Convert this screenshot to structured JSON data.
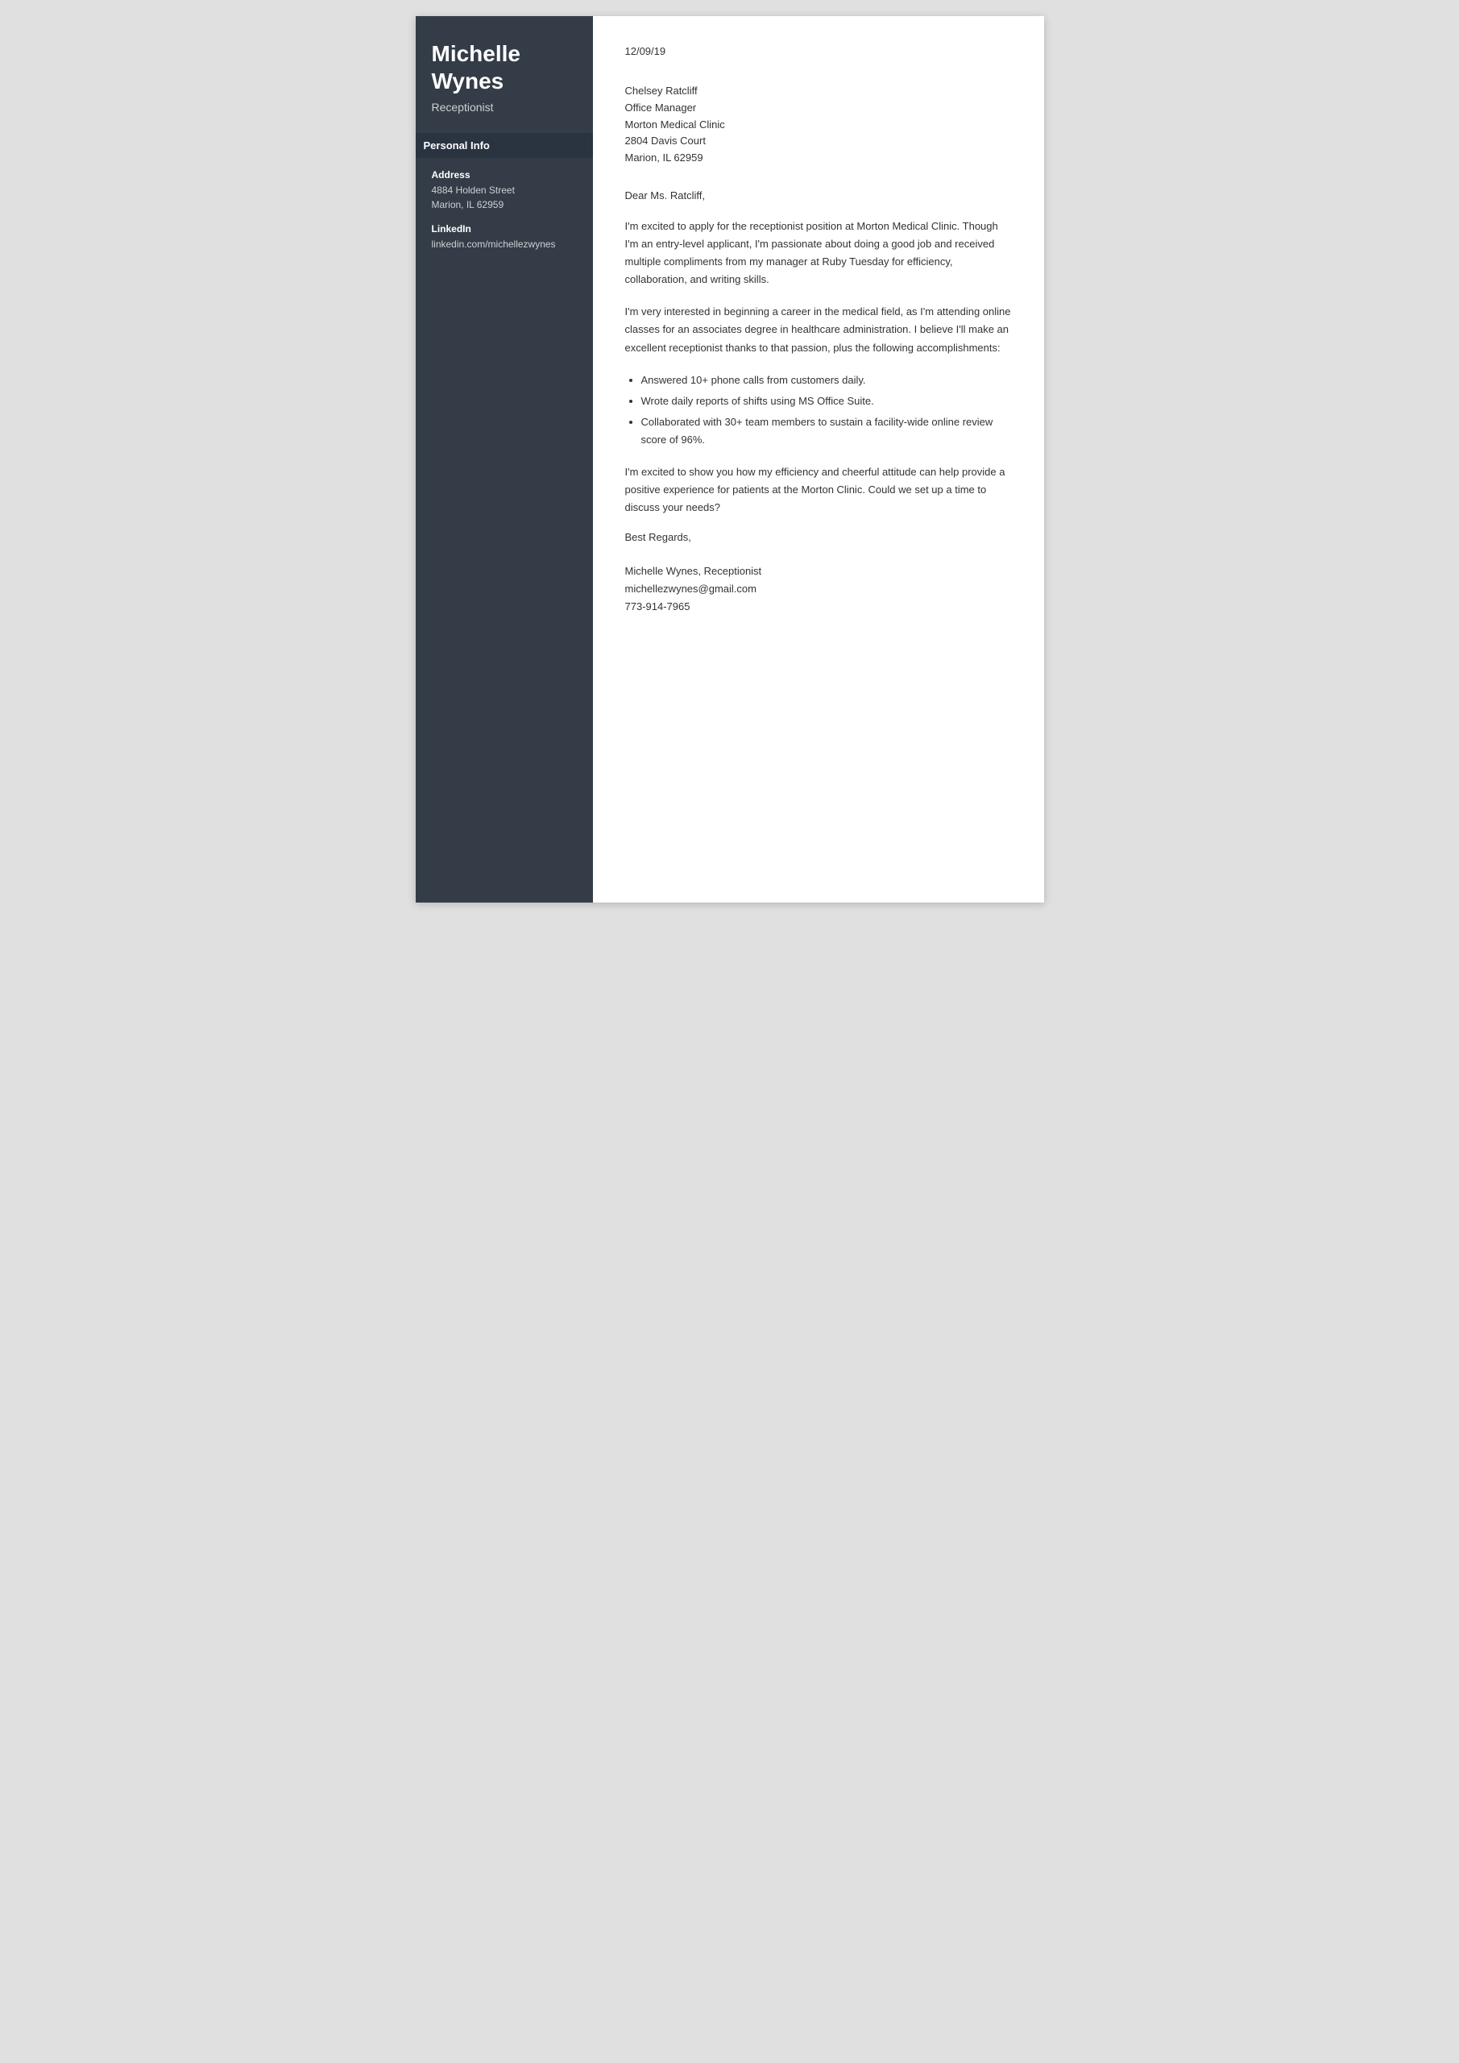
{
  "sidebar": {
    "name_line1": "Michelle",
    "name_line2": "Wynes",
    "title": "Receptionist",
    "personal_info_header": "Personal Info",
    "address_label": "Address",
    "address_line1": "4884 Holden Street",
    "address_line2": "Marion, IL 62959",
    "linkedin_label": "LinkedIn",
    "linkedin_value": "linkedin.com/michellezwynes"
  },
  "letter": {
    "date": "12/09/19",
    "recipient_name": "Chelsey Ratcliff",
    "recipient_title": "Office Manager",
    "recipient_company": "Morton Medical Clinic",
    "recipient_address": "2804 Davis Court",
    "recipient_city": "Marion, IL 62959",
    "salutation": "Dear Ms. Ratcliff,",
    "paragraph1": "I'm excited to apply for the receptionist position at Morton Medical Clinic. Though I'm an entry-level applicant, I'm passionate about doing a good job and received multiple compliments from my manager at Ruby Tuesday for efficiency, collaboration, and writing skills.",
    "paragraph2": "I'm very interested in beginning a career in the medical field, as I'm attending online classes for an associates degree in healthcare administration. I believe I'll make an excellent receptionist thanks to that passion, plus the following accomplishments:",
    "bullet1": "Answered 10+ phone calls from customers daily.",
    "bullet2": "Wrote daily reports of shifts using MS Office Suite.",
    "bullet3": "Collaborated with 30+ team members to sustain a facility-wide online review score of 96%.",
    "paragraph3": "I'm excited to show you how my efficiency and cheerful attitude can help provide a positive experience for patients at the Morton Clinic. Could we set up a time to discuss your needs?",
    "closing": "Best Regards,",
    "signature_name": "Michelle Wynes, Receptionist",
    "signature_email": "michellezwynes@gmail.com",
    "signature_phone": "773-914-7965"
  }
}
